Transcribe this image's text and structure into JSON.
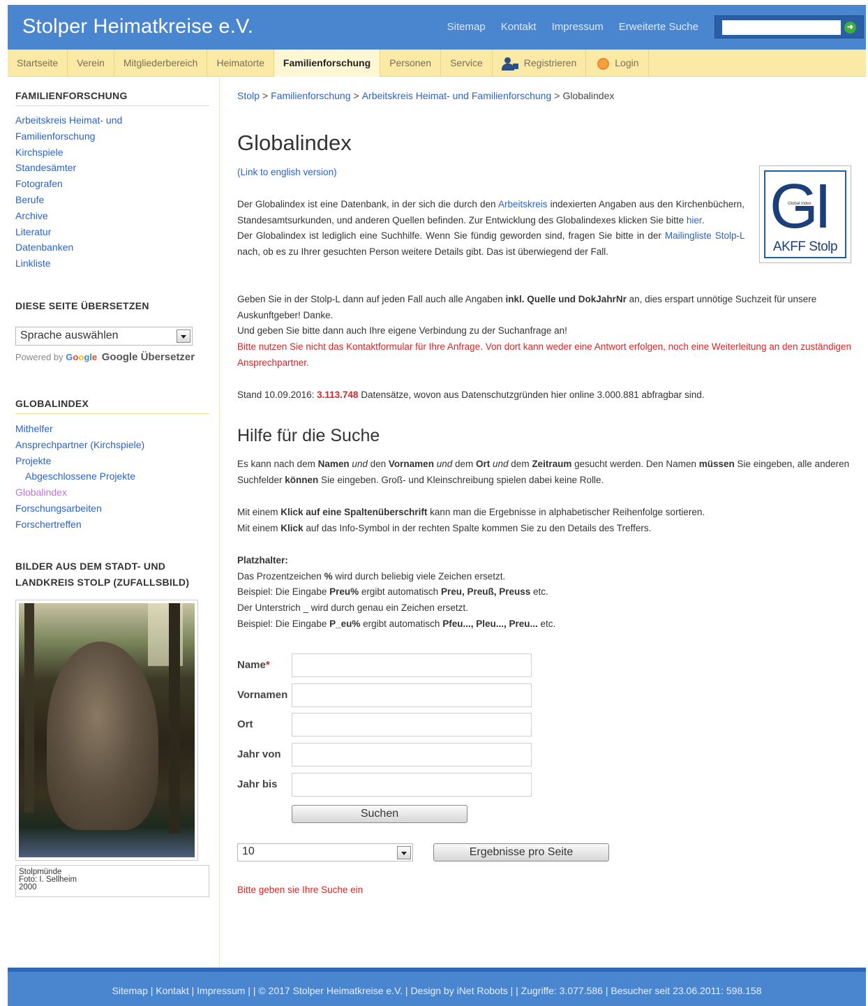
{
  "header": {
    "site_title": "Stolper Heimatkreise e.V.",
    "top_links": [
      "Sitemap",
      "Kontakt",
      "Impressum",
      "Erweiterte Suche"
    ],
    "search_placeholder": ""
  },
  "nav": [
    {
      "label": "Startseite"
    },
    {
      "label": "Verein"
    },
    {
      "label": "Mitgliederbereich"
    },
    {
      "label": "Heimatorte"
    },
    {
      "label": "Familienforschung",
      "active": true
    },
    {
      "label": "Personen"
    },
    {
      "label": "Service"
    },
    {
      "label": "Registrieren",
      "icon": "user-add-icon"
    },
    {
      "label": "Login",
      "icon": "login-icon"
    }
  ],
  "sidebar": {
    "familienforschung": {
      "heading": "FAMILIENFORSCHUNG",
      "items": [
        "Arbeitskreis Heimat- und",
        "Familienforschung",
        "Kirchspiele",
        "Standesämter",
        "Fotografen",
        "Berufe",
        "Archive",
        "Literatur",
        "Datenbanken",
        "Linkliste"
      ]
    },
    "translate": {
      "heading": "DIESE SEITE ÜBERSETZEN",
      "select_value": "Sprache auswählen",
      "powered_by": "Powered by",
      "google_logo": "Google",
      "google_translate": "Google Übersetzer"
    },
    "globalindex": {
      "heading": "GLOBALINDEX",
      "items": [
        "Mithelfer",
        "Ansprechpartner (Kirchspiele)",
        "Projekte",
        "Abgeschlossene Projekte",
        "Globalindex",
        "Forschungsarbeiten",
        "Forschertreffen"
      ]
    },
    "bilder": {
      "heading_line1": "BILDER AUS DEM STADT- UND",
      "heading_line2": "LANDKREIS STOLP (ZUFALLSBILD)",
      "caption_line1": "Stolpmünde",
      "caption_line2": "Foto: I. Sellheim",
      "caption_line3": "2000"
    }
  },
  "breadcrumb": [
    "Stolp",
    "Familienforschung",
    "Arbeitskreis Heimat- und Familienforschung",
    "Globalindex"
  ],
  "breadcrumb_sep": ">",
  "main": {
    "title": "Globalindex",
    "english_link": "(Link to english version)",
    "logo_text": "GI",
    "logo_tag": "Global Index",
    "logo_sub": "AKFF Stolp",
    "intro1_a": "Der Globalindex ist eine Datenbank, in der sich die durch den ",
    "intro1_link": "Arbeitskreis",
    "intro1_b": " indexierten Angaben aus den Kirchenbüchern, Standesamtsurkunden, und anderen Quellen befinden. Zur Entwicklung des Globalindexes klicken Sie bitte ",
    "intro1_hier": "hier",
    "intro1_c": ".",
    "intro2_a": "Der Globalindex ist lediglich eine Suchhilfe. Wenn Sie fündig geworden sind, fragen Sie bitte in der ",
    "intro2_link": "Mailingliste Stolp-L",
    "intro2_b": " nach, ob es zu Ihrer gesuchten Person weitere Details gibt. Das ist überwiegend der Fall.",
    "intro3_a": "Geben Sie in der Stolp-L dann auf jeden Fall auch alle Angaben ",
    "intro3_bold": "inkl. Quelle und DokJahrNr",
    "intro3_b": " an, dies erspart unnötige Suchzeit für unsere Auskunftgeber! Danke.",
    "intro4": "Und geben Sie bitte dann auch Ihre eigene Verbindung zu der Suchanfrage an!",
    "warning": "Bitte nutzen Sie nicht das Kontaktformular für Ihre Anfrage. Von dort kann weder eine Antwort erfolgen, noch eine Weiterleitung an den zuständigen Ansprechpartner.",
    "stand_a": "Stand 10.09.2016: ",
    "stand_count": "3.113.748",
    "stand_b": " Datensätze, wovon aus Datenschutzgründen hier online 3.000.881 abfragbar sind.",
    "help_title": "Hilfe für die Suche",
    "help1_a": "Es kann nach dem ",
    "help1_namen": "Namen",
    "help1_und1": "und",
    "help1_den": " den ",
    "help1_vornamen": "Vornamen",
    "help1_und2": "und",
    "help1_dem": " dem ",
    "help1_ort": "Ort",
    "help1_und3": "und",
    "help1_dem2": " dem ",
    "help1_zeitraum": "Zeitraum",
    "help1_b": " gesucht werden. Den Namen ",
    "help1_muessen": "müssen",
    "help1_c": " Sie eingeben, alle anderen Suchfelder ",
    "help1_koennen": "können",
    "help1_d": " Sie eingeben. Groß- und Kleinschreibung spielen dabei keine Rolle.",
    "help2_a": "Mit einem ",
    "help2_bold": "Klick auf eine Spaltenüberschrift",
    "help2_b": " kann man die Ergebnisse in alphabetischer Reihenfolge sortieren.",
    "help3_a": "Mit einem ",
    "help3_bold": "Klick",
    "help3_b": " auf das Info-Symbol in der rechten Spalte kommen Sie zu den Details des Treffers.",
    "wild_title": "Platzhalter:",
    "wild1_a": "Das Prozentzeichen ",
    "wild1_bold": "%",
    "wild1_b": " wird durch beliebig viele Zeichen ersetzt.",
    "wild2_a": "Beispiel: Die Eingabe ",
    "wild2_bold": "Preu%",
    "wild2_b": " ergibt automatisch ",
    "wild2_result": "Preu, Preuß, Preuss",
    "wild2_c": " etc.",
    "wild3": "Der Unterstrich _ wird durch genau ein Zeichen ersetzt.",
    "wild4_a": "Beispiel: Die Eingabe ",
    "wild4_bold": "P_eu%",
    "wild4_b": " ergibt automatisch ",
    "wild4_result": "Pfeu..., Pleu..., Preu...",
    "wild4_c": " etc."
  },
  "form": {
    "name_label": "Name",
    "required_mark": "*",
    "vornamen_label": "Vornamen",
    "ort_label": "Ort",
    "jahr_von_label": "Jahr von",
    "jahr_bis_label": "Jahr bis",
    "search_button": "Suchen",
    "per_page_value": "10",
    "per_page_button": "Ergebnisse pro Seite",
    "status_message": "Bitte geben sie Ihre Suche ein"
  },
  "footer": {
    "text": "Sitemap | Kontakt | Impressum | | © 2017 Stolper Heimatkreise e.V. | Design by iNet Robots | | Zugriffe: 3.077.586 | Besucher seit 23.06.2011: 598.158"
  },
  "colors": {
    "header_blue": "#4a86cf",
    "nav_yellow": "#fbeaa6",
    "link_blue": "#2a62c9",
    "warning_red": "#e02222"
  }
}
